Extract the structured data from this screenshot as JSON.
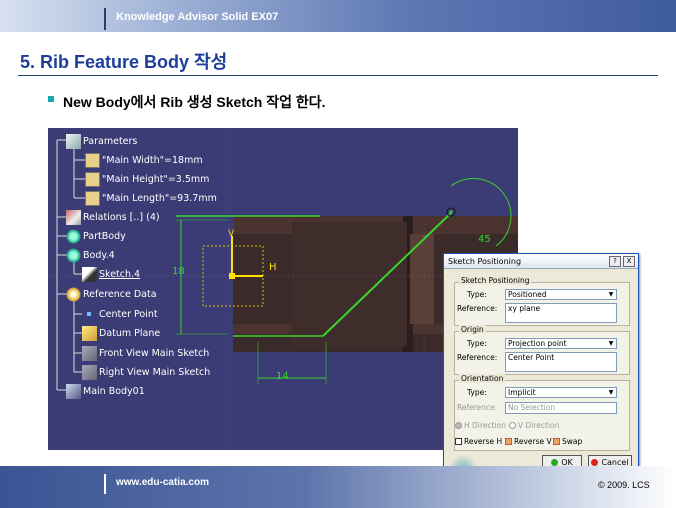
{
  "header": {
    "course": "Knowledge Advisor Solid EX07"
  },
  "slide": {
    "title": "5. Rib Feature Body 작성",
    "subtitle": "New Body에서 Rib 생성 Sketch 작업 한다."
  },
  "tree": {
    "parameters": "Parameters",
    "main_width": "\"Main Width\"=18mm",
    "main_height": "\"Main Height\"=3.5mm",
    "main_length": "\"Main Length\"=93.7mm",
    "relations": "Relations [..] (4)",
    "partbody": "PartBody",
    "body4": "Body.4",
    "sketch4": "Sketch.4",
    "reference_data": "Reference Data",
    "center_point": "Center Point",
    "datum_plane": "Datum Plane",
    "front_view": "Front View Main Sketch",
    "right_view": "Right View Main Sketch",
    "main_body01": "Main Body01"
  },
  "sketch": {
    "dim_18": "18",
    "dim_14": "14",
    "dim_45": "45",
    "axis_h": "H",
    "axis_v": "V",
    "colors": {
      "sketch": "#39d42a",
      "axis": "#ffe000",
      "bg": "#3b3b75"
    }
  },
  "dialog": {
    "title": "Sketch Positioning",
    "help": "?",
    "close": "X",
    "group1": "Sketch Positioning",
    "type_label": "Type:",
    "type1": "Positioned",
    "ref_label": "Reference:",
    "ref1": "xy plane",
    "group2": "Origin",
    "type2": "Projection point",
    "ref2": "Center Point",
    "group3": "Orientation",
    "type3": "Implicit",
    "ref3": "No Selection",
    "h_dir": "H Direction",
    "v_dir": "V Direction",
    "reverse_h": "Reverse H",
    "reverse_v": "Reverse V",
    "swap": "Swap",
    "ok": "OK",
    "cancel": "Cancel"
  },
  "footer": {
    "url": "www.edu-catia.com",
    "copyright": "© 2009. LCS"
  }
}
